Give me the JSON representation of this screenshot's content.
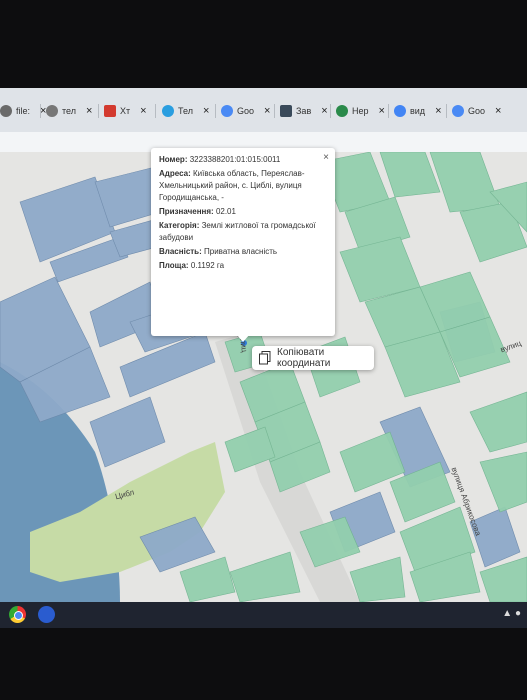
{
  "tabs": [
    {
      "label": "file:",
      "color": "#6a6a6a"
    },
    {
      "label": "тел",
      "color": "#777777"
    },
    {
      "label": "Хт",
      "color": "#d33a2f"
    },
    {
      "label": "Тел",
      "color": "#2a9ee0"
    },
    {
      "label": "Goo",
      "color": "#4a8af4"
    },
    {
      "label": "Зав",
      "color": "#3a4a5a"
    },
    {
      "label": "Нер",
      "color": "#2a8a4a"
    },
    {
      "label": "вид",
      "color": "#4285f4"
    },
    {
      "label": "Goo",
      "color": "#4a8af4"
    }
  ],
  "popup": {
    "number_label": "Номер:",
    "number_value": "3223388201:01:015:0011",
    "address_label": "Адреса:",
    "address_value": "Київська область, Переяслав-Хмельницький район, с. Циблі, вулиця Городищанська, -",
    "purpose_label": "Призначення:",
    "purpose_value": "02.01",
    "category_label": "Категорія:",
    "category_value": "Землі житлової та громадської забудови",
    "ownership_label": "Власність:",
    "ownership_value": "Приватна власність",
    "area_label": "Площа:",
    "area_value": "0.1192 га",
    "close": "×"
  },
  "context_menu": {
    "copy_label": "Копіювати координати"
  },
  "streets": {
    "s1": "вулиця Абрикосова",
    "s2": "вулиц",
    "s3": "вулиц",
    "s4": "Цибл"
  },
  "colors": {
    "parcel_blue": "#8eaac9",
    "parcel_green": "#93cfae",
    "water": "#6c96b8",
    "forest": "#c6dba6"
  }
}
